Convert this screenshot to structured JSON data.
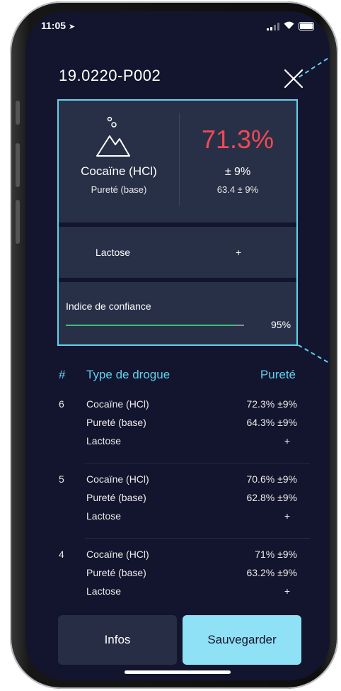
{
  "status_bar": {
    "time": "11:05",
    "location_icon": "location-arrow-icon",
    "icons": [
      "signal-icon",
      "wifi-icon",
      "battery-icon"
    ]
  },
  "header": {
    "title": "19.0220-P002",
    "close_icon": "close-icon"
  },
  "result_card": {
    "icon": "mountain-icon",
    "drug_name": "Cocaïne (HCl)",
    "purity_label": "Pureté (base)",
    "purity_percent": "71.3%",
    "purity_margin": "± 9%",
    "purity_base": "63.4 ± 9%",
    "adulterant_name": "Lactose",
    "adulterant_value": "+",
    "confidence_label": "Indice de confiance",
    "confidence_value": "95%",
    "confidence_fraction": 0.95
  },
  "table": {
    "headers": {
      "num": "#",
      "type": "Type de drogue",
      "purity": "Pureté"
    },
    "rows": [
      {
        "num": "6",
        "lines": [
          {
            "label": "Cocaïne (HCl)",
            "value": "72.3% ±9%"
          },
          {
            "label": "Pureté (base)",
            "value": "64.3% ±9%"
          },
          {
            "label": "Lactose",
            "value": "+"
          }
        ]
      },
      {
        "num": "5",
        "lines": [
          {
            "label": "Cocaïne (HCl)",
            "value": "70.6% ±9%"
          },
          {
            "label": "Pureté (base)",
            "value": "62.8% ±9%"
          },
          {
            "label": "Lactose",
            "value": "+"
          }
        ]
      },
      {
        "num": "4",
        "lines": [
          {
            "label": "Cocaïne (HCl)",
            "value": "71% ±9%"
          },
          {
            "label": "Pureté (base)",
            "value": "63.2% ±9%"
          },
          {
            "label": "Lactose",
            "value": "+"
          }
        ]
      }
    ]
  },
  "buttons": {
    "infos": "Infos",
    "save": "Sauvegarder"
  },
  "colors": {
    "background": "#13142d",
    "card": "#283047",
    "accent": "#5fd3ee",
    "purity_red": "#ef4a54",
    "confidence_green": "#3fbf79",
    "save_button": "#8fe1f6"
  }
}
